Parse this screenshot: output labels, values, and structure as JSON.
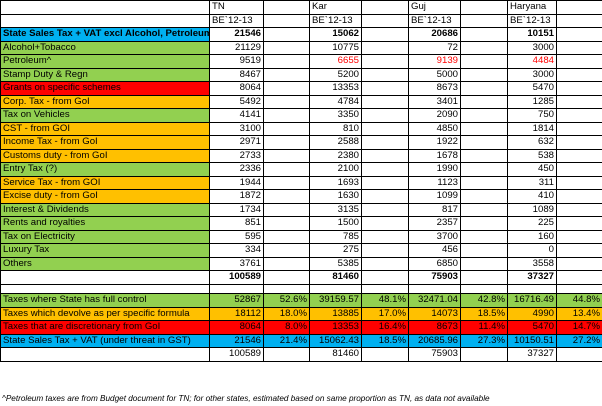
{
  "colors": {
    "green": "#92d050",
    "orange": "#ffc000",
    "red": "#ff0000",
    "blue": "#00b0f0"
  },
  "header": {
    "row1": [
      "",
      "TN",
      "",
      "Kar",
      "",
      "Guj",
      "",
      "Haryana",
      ""
    ],
    "row2": [
      "",
      "BE`12-13",
      "",
      "BE`12-13",
      "",
      "BE`12-13",
      "",
      "BE`12-13",
      ""
    ]
  },
  "rows": [
    {
      "label": "State Sales Tax + VAT excl Alcohol, Petroleum",
      "color": "blue",
      "bold": true,
      "tn": "21546",
      "kar": "15062",
      "guj": "20686",
      "har": "10151"
    },
    {
      "label": "Alcohol+Tobacco",
      "color": "green",
      "tn": "21129",
      "kar": "10775",
      "guj": "72",
      "har": "3000"
    },
    {
      "label": "Petroleum^",
      "color": "green",
      "tn": "9519",
      "kar": "6655",
      "guj": "9139",
      "har": "4484",
      "redvals": true
    },
    {
      "label": "Stamp Duty & Regn",
      "color": "green",
      "tn": "8467",
      "kar": "5200",
      "guj": "5000",
      "har": "3000"
    },
    {
      "label": "Grants on specific schemes",
      "color": "red",
      "tn": "8064",
      "kar": "13353",
      "guj": "8673",
      "har": "5470"
    },
    {
      "label": "Corp. Tax - from GoI",
      "color": "orange",
      "tn": "5492",
      "kar": "4784",
      "guj": "3401",
      "har": "1285"
    },
    {
      "label": "Tax on Vehicles",
      "color": "green",
      "tn": "4141",
      "kar": "3350",
      "guj": "2090",
      "har": "750"
    },
    {
      "label": "CST - from GOI",
      "color": "orange",
      "tn": "3100",
      "kar": "810",
      "guj": "4850",
      "har": "1814"
    },
    {
      "label": "Income Tax - from GoI",
      "color": "orange",
      "tn": "2971",
      "kar": "2588",
      "guj": "1922",
      "har": "632"
    },
    {
      "label": "Customs duty - from GoI",
      "color": "orange",
      "tn": "2733",
      "kar": "2380",
      "guj": "1678",
      "har": "538"
    },
    {
      "label": "Entry Tax (?)",
      "color": "green",
      "tn": "2336",
      "kar": "2100",
      "guj": "1990",
      "har": "450"
    },
    {
      "label": "Service Tax - from GOI",
      "color": "orange",
      "tn": "1944",
      "kar": "1693",
      "guj": "1123",
      "har": "311"
    },
    {
      "label": "Excise duty - from GoI",
      "color": "orange",
      "tn": "1872",
      "kar": "1630",
      "guj": "1099",
      "har": "410"
    },
    {
      "label": "Interest & Dividends",
      "color": "green",
      "tn": "1734",
      "kar": "3135",
      "guj": "817",
      "har": "1089"
    },
    {
      "label": "Rents and royalties",
      "color": "green",
      "tn": "851",
      "kar": "1500",
      "guj": "2357",
      "har": "225"
    },
    {
      "label": "Tax on Electricity",
      "color": "green",
      "tn": "595",
      "kar": "785",
      "guj": "3700",
      "har": "160"
    },
    {
      "label": "Luxury Tax",
      "color": "green",
      "tn": "334",
      "kar": "275",
      "guj": "456",
      "har": "0"
    },
    {
      "label": "Others",
      "color": "green",
      "tn": "3761",
      "kar": "5385",
      "guj": "6850",
      "har": "3558"
    }
  ],
  "total": {
    "tn": "100589",
    "kar": "81460",
    "guj": "75903",
    "har": "37327"
  },
  "summary": [
    {
      "label": "Taxes where State has full control",
      "color": "green",
      "tn": "52867",
      "tn_pct": "52.6%",
      "kar": "39159.57",
      "kar_pct": "48.1%",
      "guj": "32471.04",
      "guj_pct": "42.8%",
      "har": "16716.49",
      "har_pct": "44.8%"
    },
    {
      "label": "Taxes which devolve as per specific formula",
      "color": "orange",
      "tn": "18112",
      "tn_pct": "18.0%",
      "kar": "13885",
      "kar_pct": "17.0%",
      "guj": "14073",
      "guj_pct": "18.5%",
      "har": "4990",
      "har_pct": "13.4%"
    },
    {
      "label": "Taxes that are discretionary from GoI",
      "color": "red",
      "tn": "8064",
      "tn_pct": "8.0%",
      "kar": "13353",
      "kar_pct": "16.4%",
      "guj": "8673",
      "guj_pct": "11.4%",
      "har": "5470",
      "har_pct": "14.7%"
    },
    {
      "label": "State Sales Tax + VAT (under threat in GST)",
      "color": "blue",
      "tn": "21546",
      "tn_pct": "21.4%",
      "kar": "15062.43",
      "kar_pct": "18.5%",
      "guj": "20685.96",
      "guj_pct": "27.3%",
      "har": "10150.51",
      "har_pct": "27.2%"
    }
  ],
  "summary_total": {
    "tn": "100589",
    "kar": "81460",
    "guj": "75903",
    "har": "37327"
  },
  "footnote": "^Petroleum taxes are from Budget document for TN; for other states, estimated based on same proportion as TN, as data not available"
}
